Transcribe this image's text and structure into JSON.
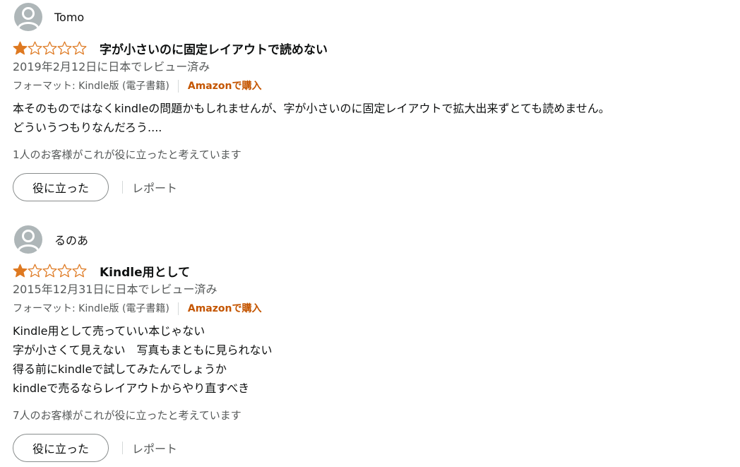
{
  "reviews": [
    {
      "profile_name": "Tomo",
      "rating": 1,
      "max_rating": 5,
      "star_color": "#de7921",
      "title": "字が小さいのに固定レイアウトで読めない",
      "date": "2019年2月12日に日本でレビュー済み",
      "format": "フォーマット: Kindle版 (電子書籍)",
      "verified": "Amazonで購入",
      "body": [
        "本そのものではなくkindleの問題かもしれませんが、字が小さいのに固定レイアウトで拡大出来ずとても読めません。",
        "どういうつもりなんだろう...."
      ],
      "helpful_count": "1人のお客様がこれが役に立ったと考えています",
      "helpful_button": "役に立った",
      "report_link": "レポート"
    },
    {
      "profile_name": "るのあ",
      "rating": 1,
      "max_rating": 5,
      "star_color": "#de7921",
      "title": "Kindle用として",
      "date": "2015年12月31日に日本でレビュー済み",
      "format": "フォーマット: Kindle版 (電子書籍)",
      "verified": "Amazonで購入",
      "body": [
        "Kindle用として売っていい本じゃない",
        "字が小さくて見えない　写真もまともに見られない",
        "得る前にkindleで試してみたんでしょうか",
        "kindleで売るならレイアウトからやり直すべき"
      ],
      "helpful_count": "7人のお客様がこれが役に立ったと考えています",
      "helpful_button": "役に立った",
      "report_link": "レポート"
    }
  ]
}
